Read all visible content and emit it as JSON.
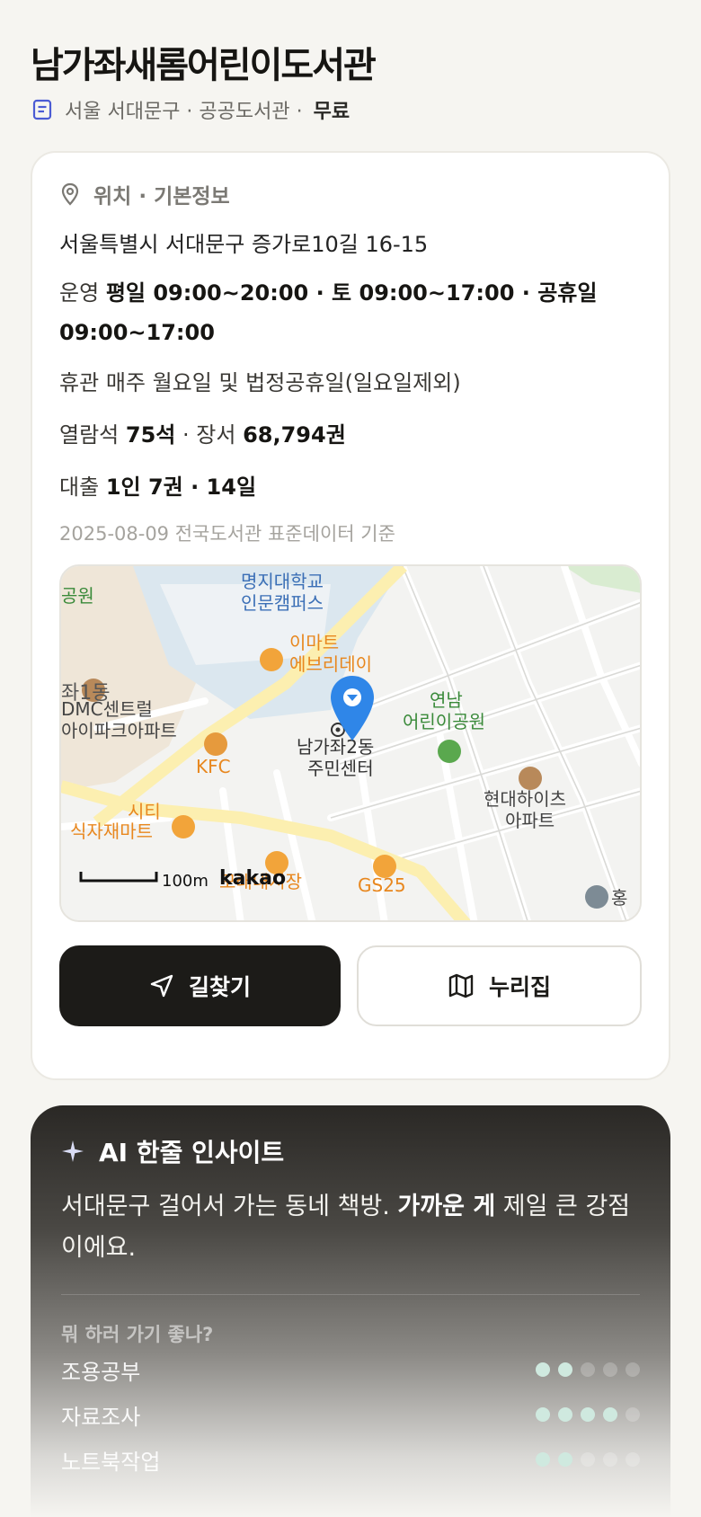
{
  "library": {
    "name": "남가좌새롬어린이도서관",
    "region": "서울 서대문구 · 공공도서관 ·",
    "fee": "무료"
  },
  "info": {
    "section_title": "위치 · 기본정보",
    "address": "서울특별시 서대문구 증가로10길 16-15",
    "hours_label": "운영",
    "hours_value": "평일 09:00~20:00 · 토 09:00~17:00 · 공휴일 09:00~17:00",
    "closed_label": "휴관",
    "closed_value": "매주 월요일 및 법정공휴일(일요일제외)",
    "seats_label": "열람석",
    "seats_value": "75석",
    "books_label": "· 장서",
    "books_value": "68,794권",
    "loan_label": "대출",
    "loan_value": "1인 7권 · 14일",
    "basis": "2025-08-09 전국도서관 표준데이터 기준"
  },
  "map": {
    "labels": {
      "myongji": "명지대학교",
      "myongji2": "인문캠퍼스",
      "park_left": "공원",
      "emart": "이마트",
      "emart2": "에브리데이",
      "dong_left": "좌1동",
      "apt_left": "DMC센트럴",
      "apt_left2": "아이파크아파트",
      "kfc": "KFC",
      "center": "남가좌2동",
      "center2": "주민센터",
      "park": "연남",
      "park2": "어린이공원",
      "hyundai": "현대하이츠",
      "hyundai2": "아파트",
      "mart": "시티",
      "mart2": "식자재마트",
      "market": "모래내시장",
      "gs25": "GS25",
      "hong": "홍"
    },
    "scale": "100m",
    "brand": "kakao"
  },
  "actions": {
    "directions": "길찾기",
    "nurijip": "누리집"
  },
  "ai": {
    "title": "AI 한줄 인사이트",
    "text_pre": "서대문구 걸어서 가는 동네 책방. ",
    "text_bold": "가까운 게",
    "text_post": " 제일 큰 강점이에요.",
    "question": "뭐 하러 가기 좋나?",
    "activities": [
      {
        "label": "조용공부",
        "score": 2
      },
      {
        "label": "자료조사",
        "score": 4
      },
      {
        "label": "노트북작업",
        "score": 2
      }
    ]
  },
  "colors": {
    "background": "#f6f5f1",
    "dark_button": "#1c1b18",
    "map_pin": "#2f86e8",
    "dot_on": "#cfe9df"
  }
}
